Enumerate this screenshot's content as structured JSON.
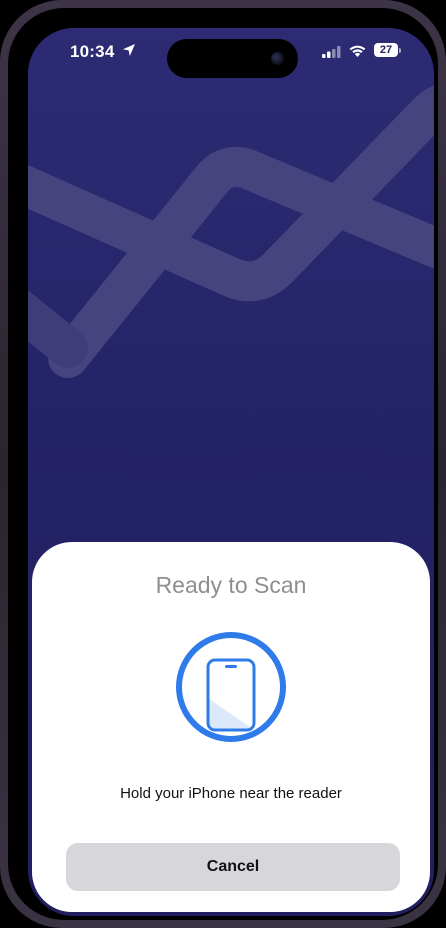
{
  "status_bar": {
    "time": "10:34",
    "battery_level": "27",
    "icons": [
      "location-arrow-icon",
      "cellular-signal-icon",
      "wifi-icon",
      "battery-icon"
    ]
  },
  "scan_sheet": {
    "title": "Ready to Scan",
    "graphic_icon": "phone-in-circle-icon",
    "message": "Hold your iPhone near the reader",
    "cancel_label": "Cancel"
  },
  "colors": {
    "background": "#252367",
    "wave": "#4a4883",
    "sheet": "#ffffff",
    "accent_blue": "#2f7bea",
    "title_gray": "#8e8e93",
    "button_gray": "#d6d6db"
  }
}
